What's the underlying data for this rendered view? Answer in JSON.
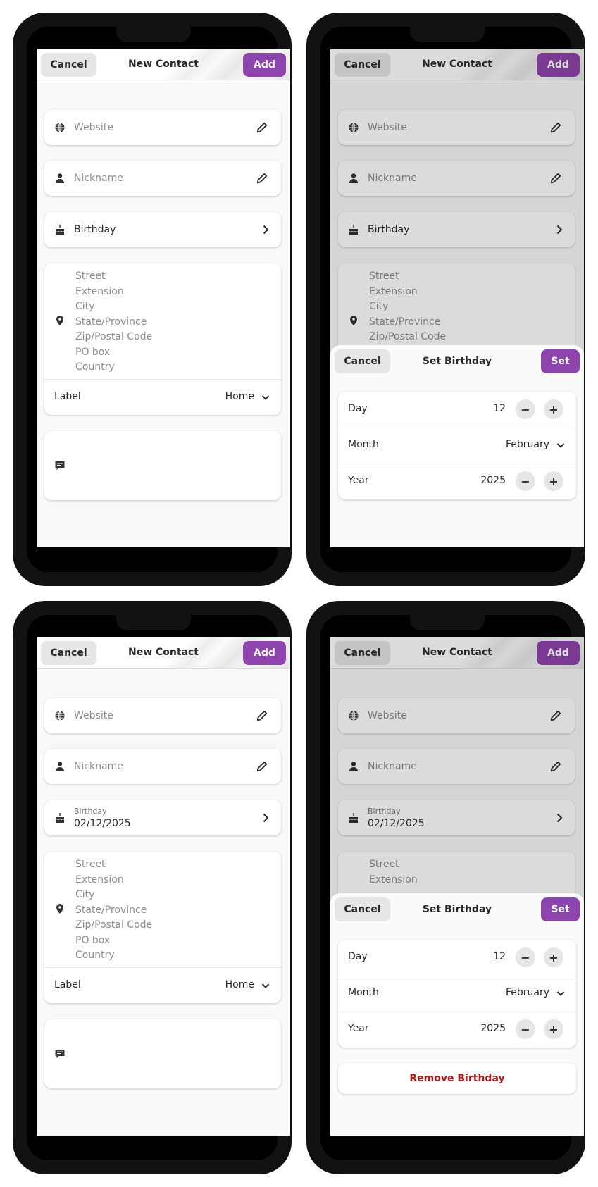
{
  "colors": {
    "accent": "#8e44ad",
    "destructive": "#b01b1b",
    "frame": "#121212"
  },
  "headerbar": {
    "cancel_label": "Cancel",
    "title": "New Contact",
    "add_label": "Add"
  },
  "form": {
    "website_placeholder": "Website",
    "nickname_placeholder": "Nickname",
    "birthday_label": "Birthday",
    "birthday_value": "02/12/2025",
    "address_fields": [
      "Street",
      "Extension",
      "City",
      "State/Province",
      "Zip/Postal Code",
      "PO box",
      "Country"
    ],
    "address_label_caption": "Label",
    "address_label_value": "Home"
  },
  "birthday_dialog": {
    "cancel_label": "Cancel",
    "title": "Set Birthday",
    "set_label": "Set",
    "day_label": "Day",
    "day_value": "12",
    "month_label": "Month",
    "month_value": "February",
    "year_label": "Year",
    "year_value": "2025",
    "remove_label": "Remove Birthday"
  },
  "icons": [
    "globe-icon",
    "person-icon",
    "cake-icon",
    "location-pin-icon",
    "note-icon",
    "pencil-icon",
    "chevron-right-icon",
    "chevron-down-icon",
    "minus-icon",
    "plus-icon"
  ]
}
